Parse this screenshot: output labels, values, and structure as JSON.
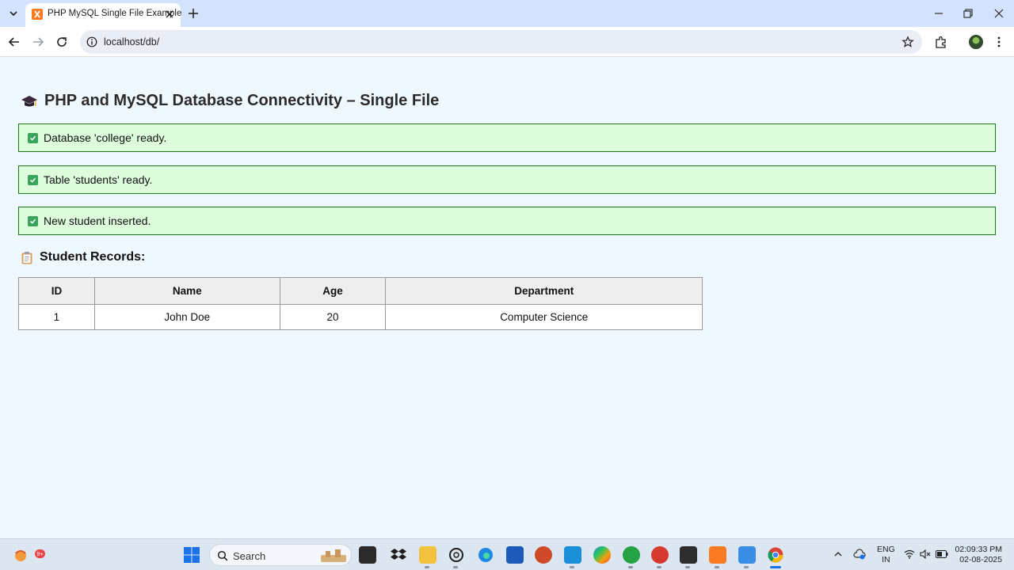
{
  "browser": {
    "tab_title": "PHP MySQL Single File Example",
    "url": "localhost/db/"
  },
  "page": {
    "title": "PHP and MySQL Database Connectivity – Single File",
    "messages": [
      "Database 'college' ready.",
      "Table 'students' ready.",
      "New student inserted."
    ],
    "section_title": "Student Records:",
    "table": {
      "headers": [
        "ID",
        "Name",
        "Age",
        "Department"
      ],
      "rows": [
        [
          "1",
          "John Doe",
          "20",
          "Computer Science"
        ]
      ]
    }
  },
  "taskbar": {
    "search_label": "Search",
    "notification_badge": "9+",
    "language": "ENG",
    "region": "IN",
    "time": "02:09:33 PM",
    "date": "02-08-2025"
  },
  "colors": {
    "page_bg": "#f0f8ff",
    "success_bg": "#dcfcdc",
    "success_border": "#1f7a1f",
    "tab_strip": "#d3e3fd"
  }
}
